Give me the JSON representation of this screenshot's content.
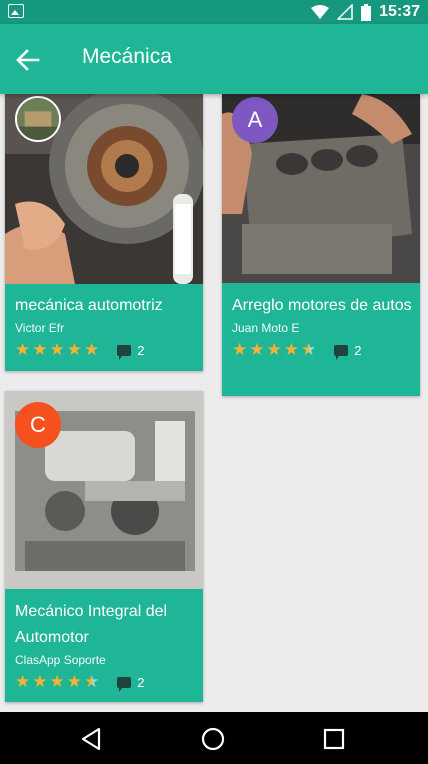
{
  "status_bar": {
    "time": "15:37"
  },
  "toolbar": {
    "title": "Mecánica"
  },
  "cards": [
    {
      "title": "mecánica automotriz",
      "author": "Victor Efr",
      "rating": 5,
      "comments": "2",
      "avatar_letter": ""
    },
    {
      "title": "Arreglo motores de autos",
      "author": "Juan Moto E",
      "rating": 4.5,
      "comments": "2",
      "avatar_letter": "A",
      "avatar_color": "#7e57c2"
    },
    {
      "title": "Mecánico Integral del Automotor",
      "author": "ClasApp Soporte",
      "rating": 4.5,
      "comments": "2",
      "avatar_letter": "C",
      "avatar_color": "#f4511e"
    }
  ],
  "colors": {
    "primary": "#1fb597",
    "primary_dark": "#16987e",
    "star": "#f5b335"
  }
}
